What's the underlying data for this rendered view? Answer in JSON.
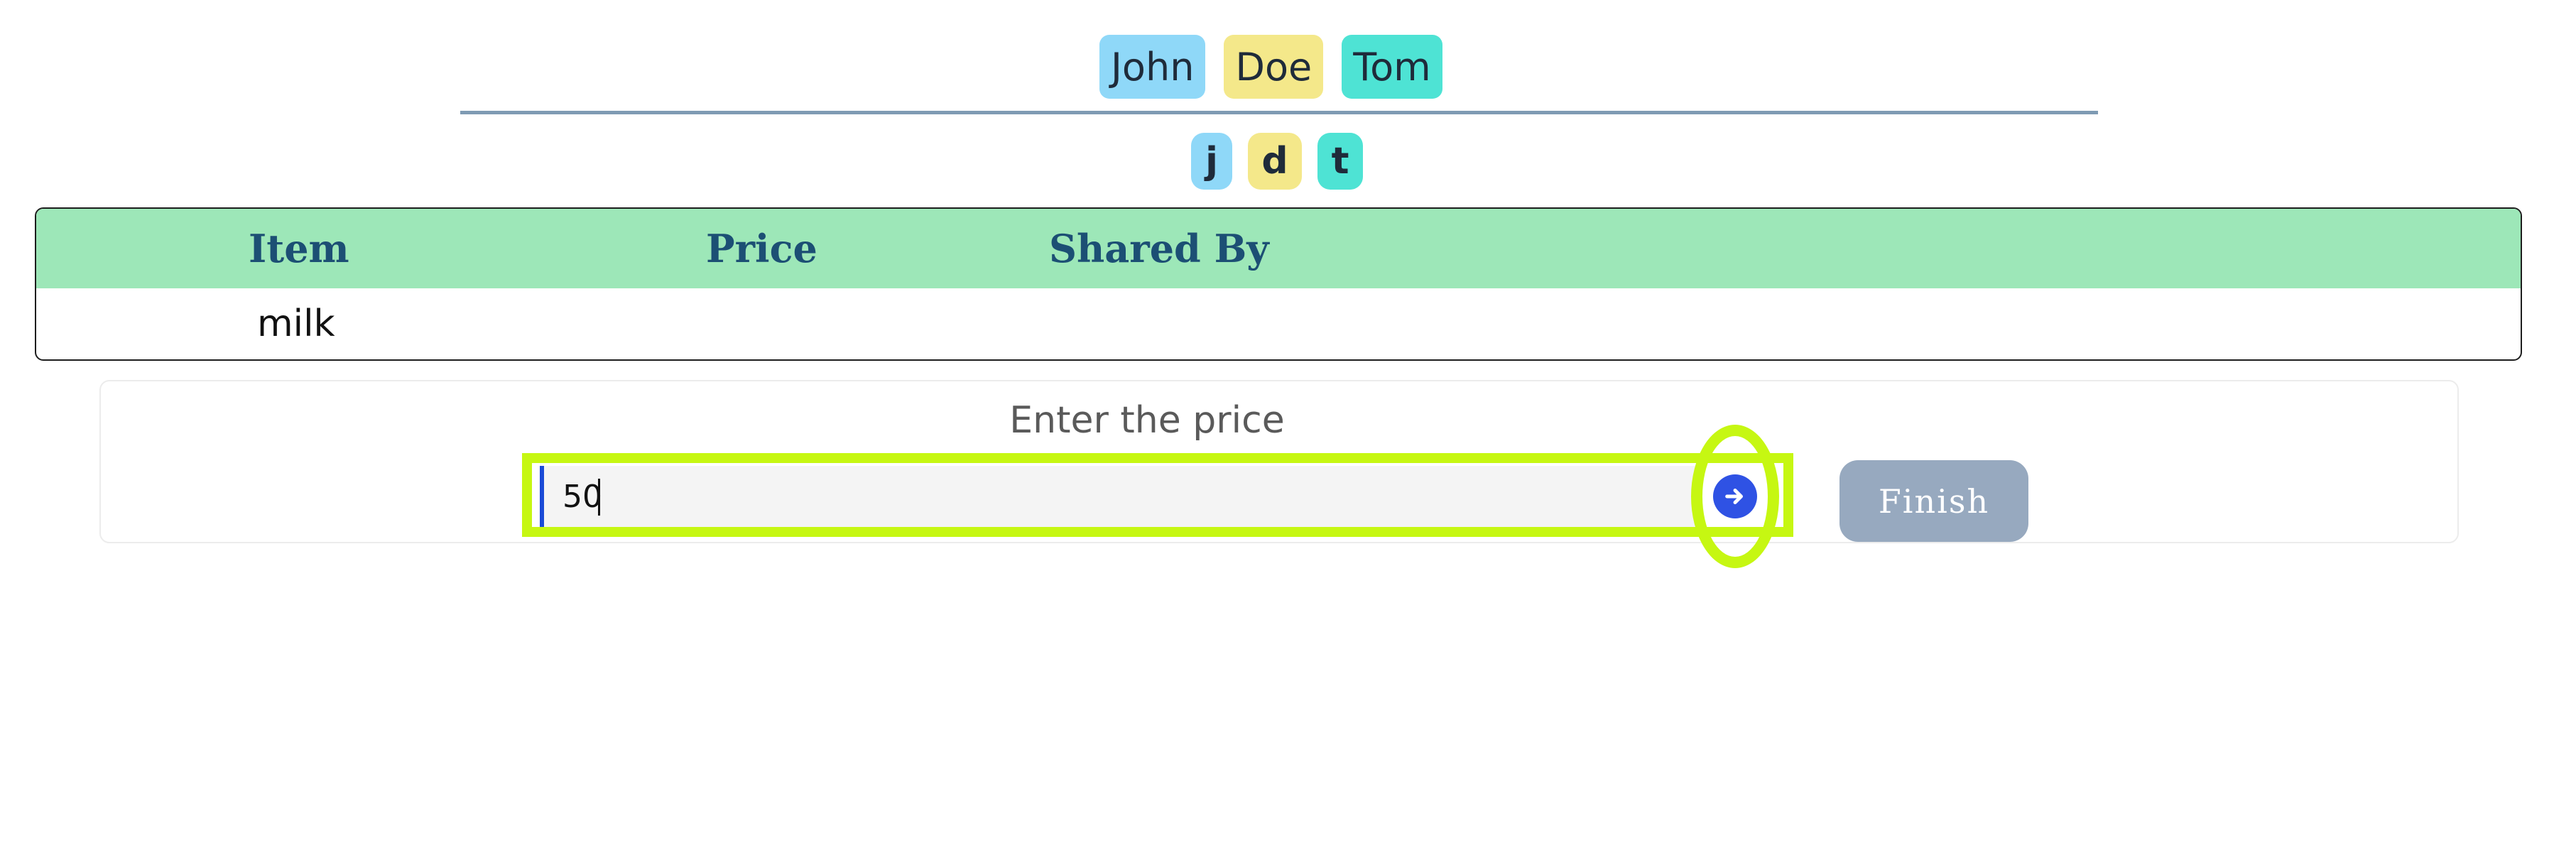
{
  "people": [
    {
      "name": "John",
      "color": "#8fd8f8"
    },
    {
      "name": "Doe",
      "color": "#f4e88a"
    },
    {
      "name": "Tom",
      "color": "#4ee3d4"
    }
  ],
  "initials": [
    {
      "letter": "j",
      "color": "#8fd8f8"
    },
    {
      "letter": "d",
      "color": "#f4e88a"
    },
    {
      "letter": "t",
      "color": "#4ee3d4"
    }
  ],
  "table": {
    "headers": [
      "Item",
      "Price",
      "Shared By"
    ],
    "rows": [
      {
        "item": "milk",
        "price": "",
        "shared_by": ""
      }
    ],
    "header_color": "#9de7b8"
  },
  "price_entry": {
    "label": "Enter the price",
    "value": "50",
    "submit_icon": "arrow-right-icon",
    "finish_label": "Finish"
  },
  "highlight_color": "#c6f712"
}
